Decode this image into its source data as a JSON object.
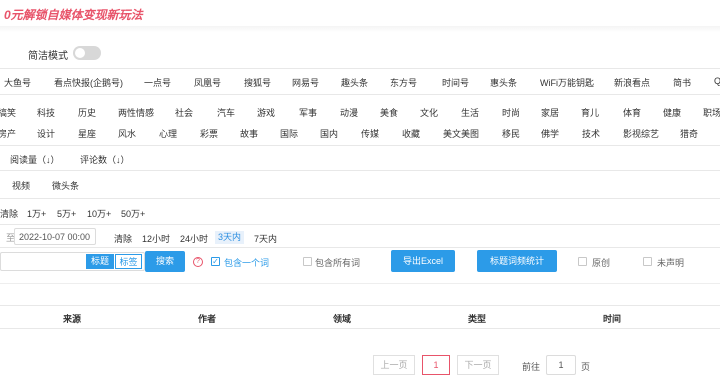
{
  "banner": {
    "title": "0元解锁自媒体变现新玩法"
  },
  "mode": {
    "label": "简洁模式"
  },
  "platforms": [
    "大鱼号",
    "看点快报(企鹅号)",
    "一点号",
    "凤凰号",
    "搜狐号",
    "网易号",
    "趣头条",
    "东方号",
    "时间号",
    "惠头条",
    "WiFi万能钥匙",
    "新浪看点",
    "简书",
    "Q"
  ],
  "categories_row1": [
    "搞笑",
    "科技",
    "历史",
    "两性情感",
    "社会",
    "汽车",
    "游戏",
    "军事",
    "动漫",
    "美食",
    "文化",
    "生活",
    "时尚",
    "家居",
    "育儿",
    "体育",
    "健康",
    "职场"
  ],
  "categories_row2": [
    "房产",
    "设计",
    "星座",
    "风水",
    "心理",
    "彩票",
    "故事",
    "国际",
    "国内",
    "传媒",
    "收藏",
    "美文美图",
    "移民",
    "佛学",
    "技术",
    "影视综艺",
    "猎奇"
  ],
  "sort": [
    "阅读量（↓）",
    "评论数（↓）"
  ],
  "content_types": [
    "视频",
    "微头条"
  ],
  "read_filters": [
    "清除",
    "1万+",
    "5万+",
    "10万+",
    "50万+"
  ],
  "time": {
    "prefix": "至",
    "date_value": "2022-10-07 00:00",
    "options": [
      "清除",
      "12小时",
      "24小时",
      "3天内",
      "7天内"
    ],
    "active": "3天内"
  },
  "search": {
    "seg_title": "标题",
    "seg_tag": "标签",
    "button": "搜索",
    "help": "?",
    "contains_one": "包含一个词",
    "contains_all": "包含所有词",
    "export": "导出Excel",
    "word_stats": "标题词频统计",
    "original": "原创",
    "no_statement": "未声明"
  },
  "table": {
    "headers": [
      "来源",
      "作者",
      "领域",
      "类型",
      "时间"
    ]
  },
  "pager": {
    "prev": "上一页",
    "current": "1",
    "next": "下一页",
    "goto_label": "前往",
    "goto_value": "1",
    "page_unit": "页"
  },
  "colors": {
    "accent": "#2c9be8",
    "brand": "#e8546a"
  }
}
